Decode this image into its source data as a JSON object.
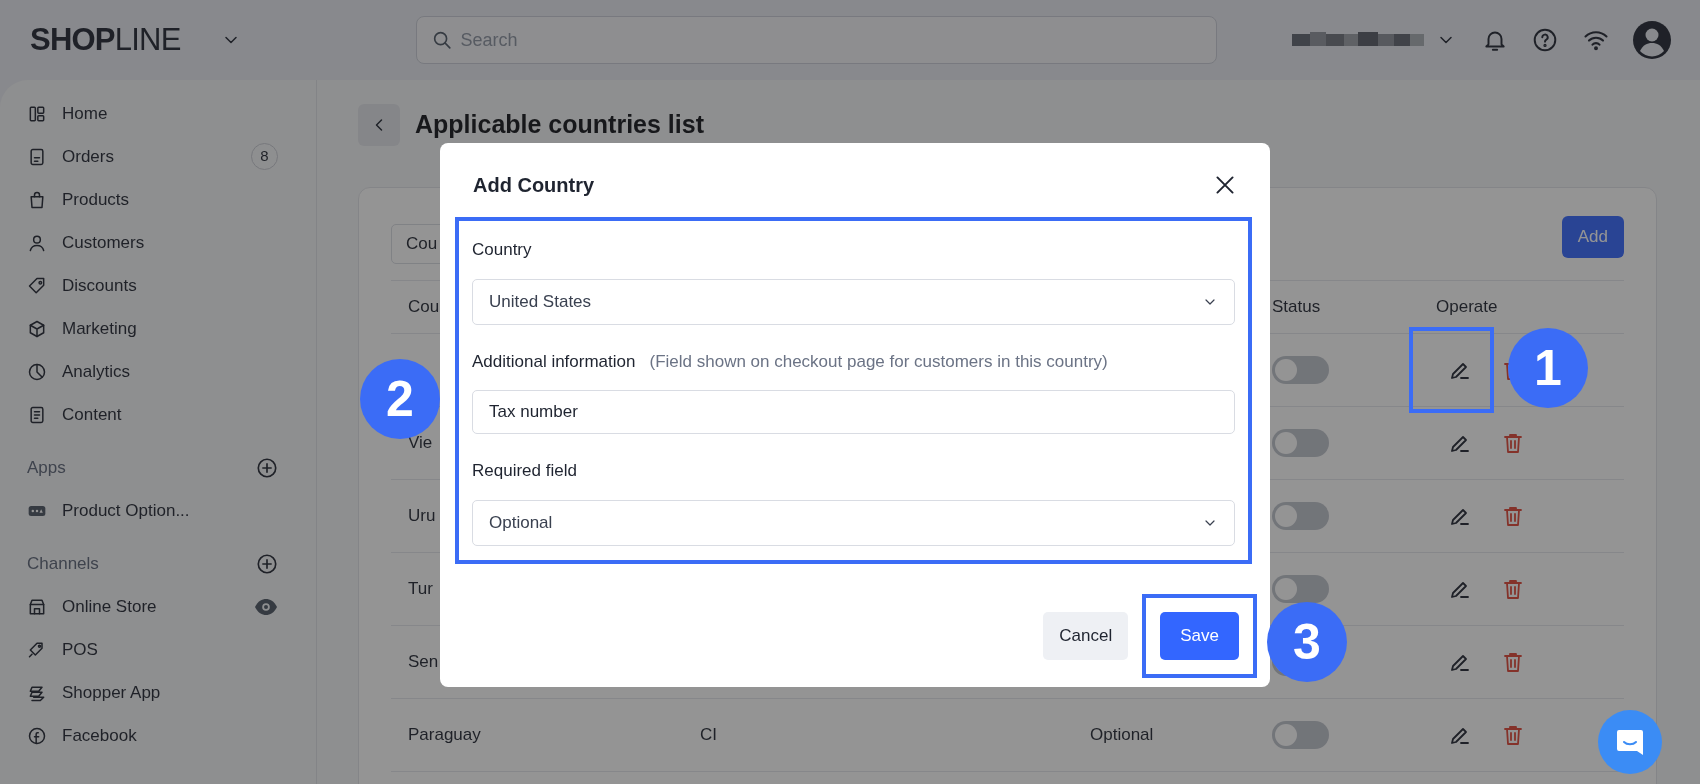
{
  "topbar": {
    "logo": "**SHOP**LINE",
    "search": {
      "placeholder": "Search"
    }
  },
  "sidebar": {
    "items": [
      {
        "label": "Home"
      },
      {
        "label": "Orders",
        "badge": "8"
      },
      {
        "label": "Products"
      },
      {
        "label": "Customers"
      },
      {
        "label": "Discounts"
      },
      {
        "label": "Marketing"
      },
      {
        "label": "Analytics"
      },
      {
        "label": "Content"
      }
    ],
    "sections": [
      {
        "title": "Apps",
        "items": [
          {
            "label": "Product Option..."
          }
        ]
      },
      {
        "title": "Channels",
        "items": [
          {
            "label": "Online Store"
          },
          {
            "label": "POS"
          },
          {
            "label": "Shopper App"
          },
          {
            "label": "Facebook"
          }
        ]
      }
    ]
  },
  "page": {
    "title": "Applicable countries list",
    "filter": {
      "value": "Cou"
    },
    "add_button": "Add",
    "table": {
      "columns": {
        "country": "Cou",
        "status": "Status",
        "operate": "Operate"
      },
      "rows": [
        {
          "on": false
        },
        {
          "country": "Vie",
          "on": false
        },
        {
          "country": "Uru",
          "on": false
        },
        {
          "country": "Tur",
          "on": false
        },
        {
          "country": "Sen",
          "on": false
        },
        {
          "country": "Paraguay",
          "column_2": "CI",
          "required": "Optional",
          "on": false
        }
      ]
    }
  },
  "modal": {
    "title": "Add Country",
    "fields": [
      {
        "kind": "select",
        "label": "Country",
        "value": "United States"
      },
      {
        "kind": "input",
        "label": "Additional information",
        "hint": "(Field shown on checkout page for customers in this country)",
        "value": "Tax number"
      },
      {
        "kind": "select",
        "label": "Required field",
        "value": "Optional"
      }
    ],
    "buttons": [
      {
        "kind": "secondary",
        "label": "Cancel"
      },
      {
        "kind": "primary",
        "label": "Save"
      }
    ]
  },
  "callouts": [
    {
      "label": "1"
    },
    {
      "label": "2"
    },
    {
      "label": "3"
    }
  ]
}
